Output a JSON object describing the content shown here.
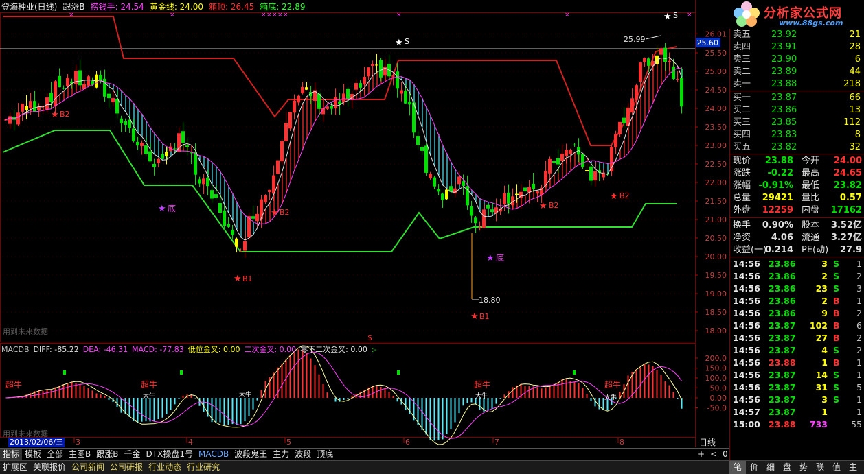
{
  "header": {
    "stock_title": "登海种业(日线)",
    "formula": "跟涨B",
    "indicators": [
      {
        "label": "捞钱手: 24.54",
        "color": "#ff40ff"
      },
      {
        "label": "黄金线: 24.00",
        "color": "#ffff00"
      },
      {
        "label": "箱顶: 26.45",
        "color": "#ff3030"
      },
      {
        "label": "箱底: 22.89",
        "color": "#30ff30"
      }
    ]
  },
  "macd": {
    "items": [
      {
        "label": "MACDB",
        "color": "#c0c0c0"
      },
      {
        "label": "DIFF: -85.22",
        "color": "#e0e0e0"
      },
      {
        "label": "DEA: -46.31",
        "color": "#ff40ff"
      },
      {
        "label": "MACD: -77.83",
        "color": "#ff40ff"
      },
      {
        "label": "低位金叉: 0.00",
        "color": "#ffff00"
      },
      {
        "label": "二次金叉: 0.00",
        "color": "#ff40ff"
      },
      {
        "label": "零下二次金叉: 0.00",
        "color": "#e0e0e0"
      },
      {
        "label": ":-",
        "color": "#00e000"
      }
    ],
    "axis": [
      "200.0",
      "150.0",
      "100.0",
      "50.0",
      "0.00",
      "-50.0"
    ],
    "labels": [
      "超牛",
      "超牛",
      "超牛",
      "超牛"
    ],
    "small_labels": [
      "大牛",
      "大牛",
      "大牛",
      "大牛"
    ]
  },
  "watermark": "用到未来数据",
  "price_axis": [
    "26.01",
    "25.50",
    "25.00",
    "24.50",
    "24.00",
    "23.50",
    "23.00",
    "22.50",
    "22.00",
    "21.50",
    "21.00",
    "20.50",
    "20.00",
    "19.50",
    "19.00",
    "18.50",
    "18.00"
  ],
  "current_price_tag": "25.60",
  "annotations": {
    "high": "25.99",
    "low": "18.80",
    "sell": "S",
    "b1": "B1",
    "b2": "B2",
    "bottom": "底",
    "dollar": "$"
  },
  "date_axis": {
    "cursor_date": "2013/02/06/三",
    "months": [
      "3",
      "4",
      "5",
      "6",
      "7",
      "8"
    ],
    "period": "日线",
    "zoom": [
      "+",
      "<",
      "0"
    ]
  },
  "logo": {
    "title": "分析家公式网",
    "url": "www.88gs.com"
  },
  "order_book": {
    "asks": [
      {
        "label": "卖五",
        "price": "23.92",
        "vol": "21"
      },
      {
        "label": "卖四",
        "price": "23.91",
        "vol": "28"
      },
      {
        "label": "卖三",
        "price": "23.90",
        "vol": "6"
      },
      {
        "label": "卖二",
        "price": "23.89",
        "vol": "44"
      },
      {
        "label": "卖一",
        "price": "23.88",
        "vol": "218"
      }
    ],
    "bids": [
      {
        "label": "买一",
        "price": "23.87",
        "vol": "66"
      },
      {
        "label": "买二",
        "price": "23.86",
        "vol": "13"
      },
      {
        "label": "买三",
        "price": "23.85",
        "vol": "112"
      },
      {
        "label": "买四",
        "price": "23.83",
        "vol": "8"
      },
      {
        "label": "买五",
        "price": "23.82",
        "vol": "32"
      }
    ]
  },
  "quote": [
    {
      "l1": "现价",
      "v1": "23.88",
      "c1": "#00e000",
      "l2": "今开",
      "v2": "24.00",
      "c2": "#ff3030"
    },
    {
      "l1": "涨跌",
      "v1": "-0.22",
      "c1": "#00e000",
      "l2": "最高",
      "v2": "24.65",
      "c2": "#ff3030"
    },
    {
      "l1": "涨幅",
      "v1": "-0.91%",
      "c1": "#00e000",
      "l2": "最低",
      "v2": "23.82",
      "c2": "#00e000"
    },
    {
      "l1": "总量",
      "v1": "29421",
      "c1": "#ffff00",
      "l2": "量比",
      "v2": "0.57",
      "c2": "#ffff00"
    },
    {
      "l1": "外盘",
      "v1": "12259",
      "c1": "#ff3030",
      "l2": "内盘",
      "v2": "17162",
      "c2": "#00e000"
    },
    {
      "l1": "换手",
      "v1": "0.90%",
      "c1": "#e0e0e0",
      "l2": "股本",
      "v2": "3.52亿",
      "c2": "#e0e0e0"
    },
    {
      "l1": "净资",
      "v1": "4.06",
      "c1": "#e0e0e0",
      "l2": "流通",
      "v2": "3.27亿",
      "c2": "#e0e0e0"
    },
    {
      "l1": "收益(一)",
      "v1": "0.214",
      "c1": "#e0e0e0",
      "l2": "PE(动)",
      "v2": "27.9",
      "c2": "#e0e0e0"
    }
  ],
  "ticks": [
    {
      "time": "14:56",
      "price": "23.86",
      "vol": "3",
      "dir": "S",
      "n": "1"
    },
    {
      "time": "14:56",
      "price": "23.86",
      "vol": "2",
      "dir": "S",
      "n": "2"
    },
    {
      "time": "14:56",
      "price": "23.86",
      "vol": "23",
      "dir": "S",
      "n": "3"
    },
    {
      "time": "14:56",
      "price": "23.86",
      "vol": "2",
      "dir": "B",
      "n": "1"
    },
    {
      "time": "14:56",
      "price": "23.86",
      "vol": "9",
      "dir": "B",
      "n": "2"
    },
    {
      "time": "14:56",
      "price": "23.87",
      "vol": "102",
      "dir": "B",
      "n": "6"
    },
    {
      "time": "14:56",
      "price": "23.87",
      "vol": "27",
      "dir": "B",
      "n": "2"
    },
    {
      "time": "14:56",
      "price": "23.87",
      "vol": "4",
      "dir": "S",
      "n": "2"
    },
    {
      "time": "14:56",
      "price": "23.88",
      "vol": "1",
      "dir": "B",
      "n": "1"
    },
    {
      "time": "14:56",
      "price": "23.87",
      "vol": "14",
      "dir": "S",
      "n": "1"
    },
    {
      "time": "14:56",
      "price": "23.87",
      "vol": "31",
      "dir": "S",
      "n": "5"
    },
    {
      "time": "14:56",
      "price": "23.87",
      "vol": "3",
      "dir": "S",
      "n": "1"
    },
    {
      "time": "14:57",
      "price": "23.87",
      "vol": "1",
      "dir": "",
      "n": "1"
    },
    {
      "time": "15:00",
      "price": "23.88",
      "vol": "733",
      "dir": "",
      "n": "55"
    }
  ],
  "bottom_tabs1": [
    "指标",
    "模板",
    "全部",
    "主图B",
    "跟涨B",
    "千金",
    "DTX操盘1号",
    "MACDB",
    "波段鬼王",
    "主力",
    "波段",
    "顶底"
  ],
  "bottom_tabs2": [
    "扩展区",
    "关联报价",
    "公司新闻",
    "公司研报",
    "行业动态",
    "行业研究"
  ],
  "side_tabs": [
    "笔",
    "价",
    "细",
    "盘",
    "势",
    "联",
    "值",
    "主"
  ],
  "colors": {
    "up": "#ff3030",
    "down": "#00e000",
    "cyan": "#54e8f8",
    "magenta": "#ff40ff",
    "yellow": "#ffff00",
    "grid": "#7a0000"
  }
}
